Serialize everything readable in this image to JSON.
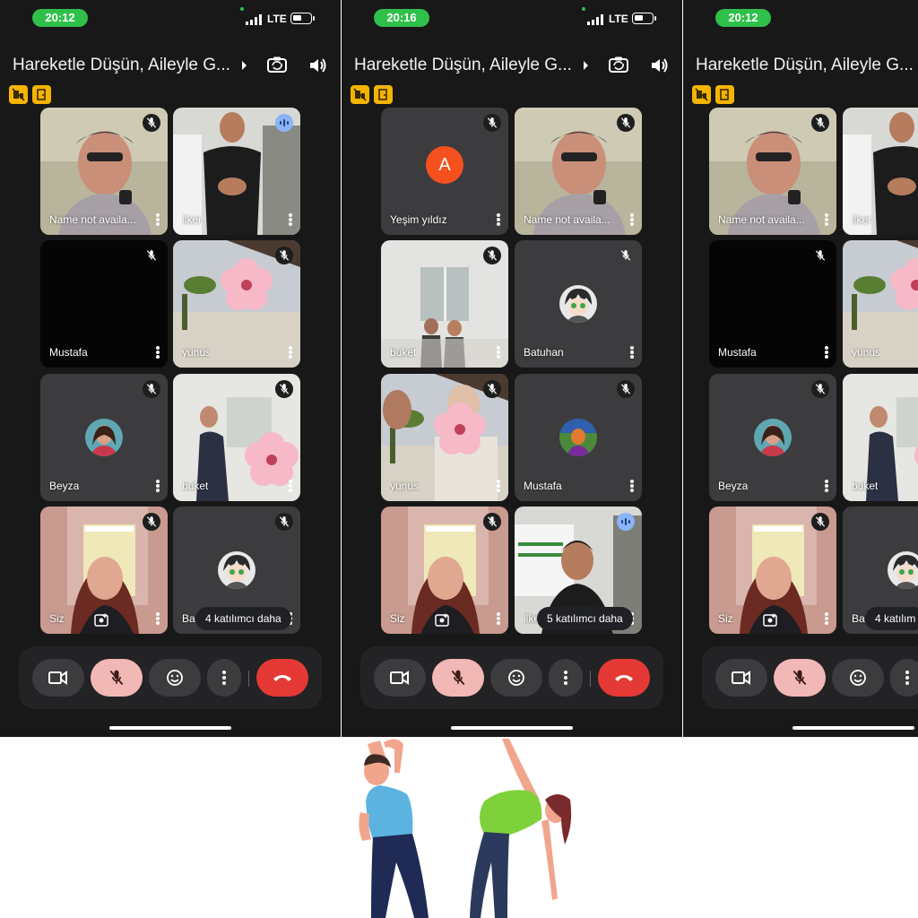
{
  "phones": [
    {
      "status": {
        "time": "20:12",
        "network": "LTE"
      },
      "meeting_title": "Hareketle Düşün, Aileyle G...",
      "tiles": [
        {
          "name": "Name not availa...",
          "state": "muted",
          "kind": "video-man-glasses"
        },
        {
          "name": "ilker",
          "state": "speaking",
          "kind": "video-man-black"
        },
        {
          "name": "Mustafa",
          "state": "muted-plain",
          "kind": "black"
        },
        {
          "name": "yunus",
          "state": "muted",
          "kind": "video-flower-outdoor"
        },
        {
          "name": "Beyza",
          "state": "muted",
          "kind": "avatar-woman"
        },
        {
          "name": "buket",
          "state": "muted",
          "kind": "video-woman-flower"
        },
        {
          "name": "Siz",
          "state": "muted",
          "kind": "video-self"
        },
        {
          "name": "Ba",
          "state": "muted",
          "kind": "avatar-anime",
          "overlay": "4 katılımcı daha"
        }
      ]
    },
    {
      "status": {
        "time": "20:16",
        "network": "LTE"
      },
      "meeting_title": "Hareketle Düşün, Aileyle G...",
      "tiles": [
        {
          "name": "Yeşim yıldız",
          "state": "muted",
          "kind": "letter",
          "letter": "A"
        },
        {
          "name": "Name not availa...",
          "state": "muted",
          "kind": "video-man-glasses"
        },
        {
          "name": "buket",
          "state": "muted",
          "kind": "video-kids"
        },
        {
          "name": "Batuhan",
          "state": "muted-plain",
          "kind": "avatar-anime"
        },
        {
          "name": "yunus",
          "state": "muted",
          "kind": "video-flower-people"
        },
        {
          "name": "Mustafa",
          "state": "muted",
          "kind": "avatar-man"
        },
        {
          "name": "Siz",
          "state": "muted",
          "kind": "video-self"
        },
        {
          "name": "ilke",
          "state": "speaking",
          "kind": "video-man-sign",
          "overlay": "5 katılımcı daha"
        }
      ]
    },
    {
      "status": {
        "time": "20:12",
        "network": ""
      },
      "meeting_title": "Hareketle Düşün, Aileyle G...",
      "tiles": [
        {
          "name": "Name not availa...",
          "state": "muted",
          "kind": "video-man-glasses"
        },
        {
          "name": "ilker",
          "state": "speaking",
          "kind": "video-man-black"
        },
        {
          "name": "Mustafa",
          "state": "muted-plain",
          "kind": "black"
        },
        {
          "name": "yunus",
          "state": "muted",
          "kind": "video-flower-outdoor"
        },
        {
          "name": "Beyza",
          "state": "muted",
          "kind": "avatar-woman"
        },
        {
          "name": "buket",
          "state": "muted",
          "kind": "video-woman-flower"
        },
        {
          "name": "Siz",
          "state": "muted",
          "kind": "video-self"
        },
        {
          "name": "Ba",
          "state": "muted",
          "kind": "avatar-anime",
          "overlay": "4 katılım"
        }
      ]
    }
  ],
  "colors": {
    "time_pill": "#2fc04b",
    "mic_off": "#f2b8b5",
    "end_call": "#e53935",
    "badge": "#f4b400"
  },
  "icons": [
    "signal-icon",
    "battery-icon",
    "camera-switch-icon",
    "speaker-icon",
    "mic-off-icon",
    "video-camera-icon",
    "emoji-icon",
    "more-vert-icon",
    "end-call-icon"
  ]
}
